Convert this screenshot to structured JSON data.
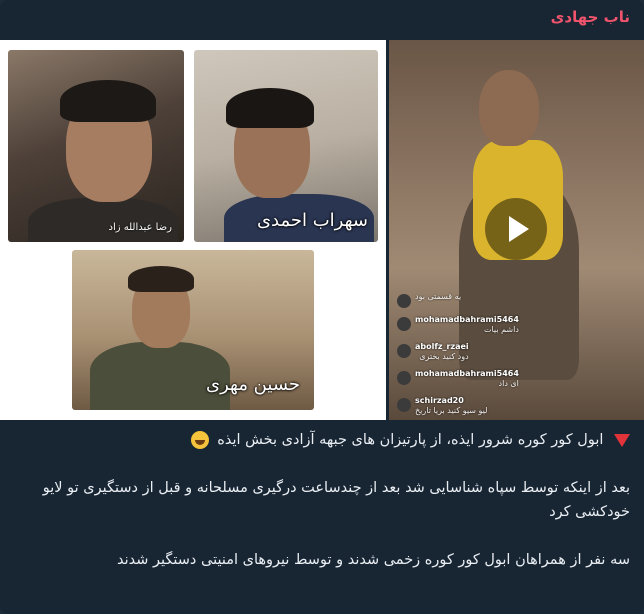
{
  "message": {
    "sender": "ناب جهادی"
  },
  "collage": {
    "photo1_caption": "رضا عبدالله زاد",
    "photo2_caption": "سهراب احمدی",
    "photo3_caption": "حسین مهری"
  },
  "video": {
    "comments": [
      {
        "name": "",
        "text": "یه قسمتی بود"
      },
      {
        "name": "mohamadbahrami5464",
        "text": "داشم بیات"
      },
      {
        "name": "abolfz_rzaei",
        "text": "دود کنید بختری"
      },
      {
        "name": "mohamadbahrami5464",
        "text": "ای داد"
      },
      {
        "name": "schirzad20",
        "text": "لیو سیو کنید بریا تاریخ"
      }
    ]
  },
  "text": {
    "line1": "ابول کور کوره شرور ایذه، از پارتیزان های جبهه آزادی بخش ایذه",
    "para2": "بعد از اینکه توسط سپاه شناسایی شد بعد از چندساعت درگیری مسلحانه و قبل از دستگیری تو لایو خودکشی کرد",
    "para3": "سه نفر از همراهان ابول کور کوره زخمی شدند و توسط نیروهای امنیتی دستگیر شدند"
  }
}
